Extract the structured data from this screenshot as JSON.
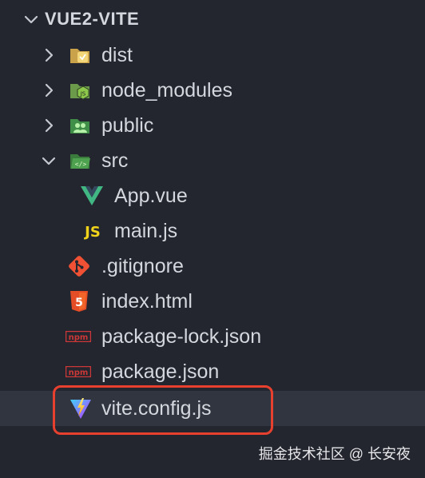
{
  "explorer": {
    "root": {
      "label": "VUE2-VITE",
      "expanded": true
    },
    "items": [
      {
        "label": "dist",
        "type": "folder",
        "icon": "dist-folder-icon"
      },
      {
        "label": "node_modules",
        "type": "folder",
        "icon": "node-modules-folder-icon"
      },
      {
        "label": "public",
        "type": "folder",
        "icon": "public-folder-icon"
      },
      {
        "label": "src",
        "type": "folder",
        "icon": "src-folder-icon"
      },
      {
        "label": "App.vue",
        "type": "file",
        "icon": "vue-file-icon"
      },
      {
        "label": "main.js",
        "type": "file",
        "icon": "js-file-icon",
        "badge": "JS"
      },
      {
        "label": ".gitignore",
        "type": "file",
        "icon": "git-file-icon"
      },
      {
        "label": "index.html",
        "type": "file",
        "icon": "html-file-icon",
        "badge": "5"
      },
      {
        "label": "package-lock.json",
        "type": "file",
        "icon": "npm-file-icon",
        "badge": "npm"
      },
      {
        "label": "package.json",
        "type": "file",
        "icon": "npm-file-icon",
        "badge": "npm"
      },
      {
        "label": "vite.config.js",
        "type": "file",
        "icon": "vite-file-icon",
        "selected": true
      }
    ]
  },
  "watermark": "掘金技术社区 @ 长安夜",
  "colors": {
    "background": "#23262e",
    "selected_row": "#31353f",
    "highlight": "#e8402f",
    "vue_green": "#41b883",
    "js_yellow": "#f0d31a",
    "html_orange": "#e44d26",
    "git_red": "#f05033",
    "npm_red": "#cb3837"
  }
}
